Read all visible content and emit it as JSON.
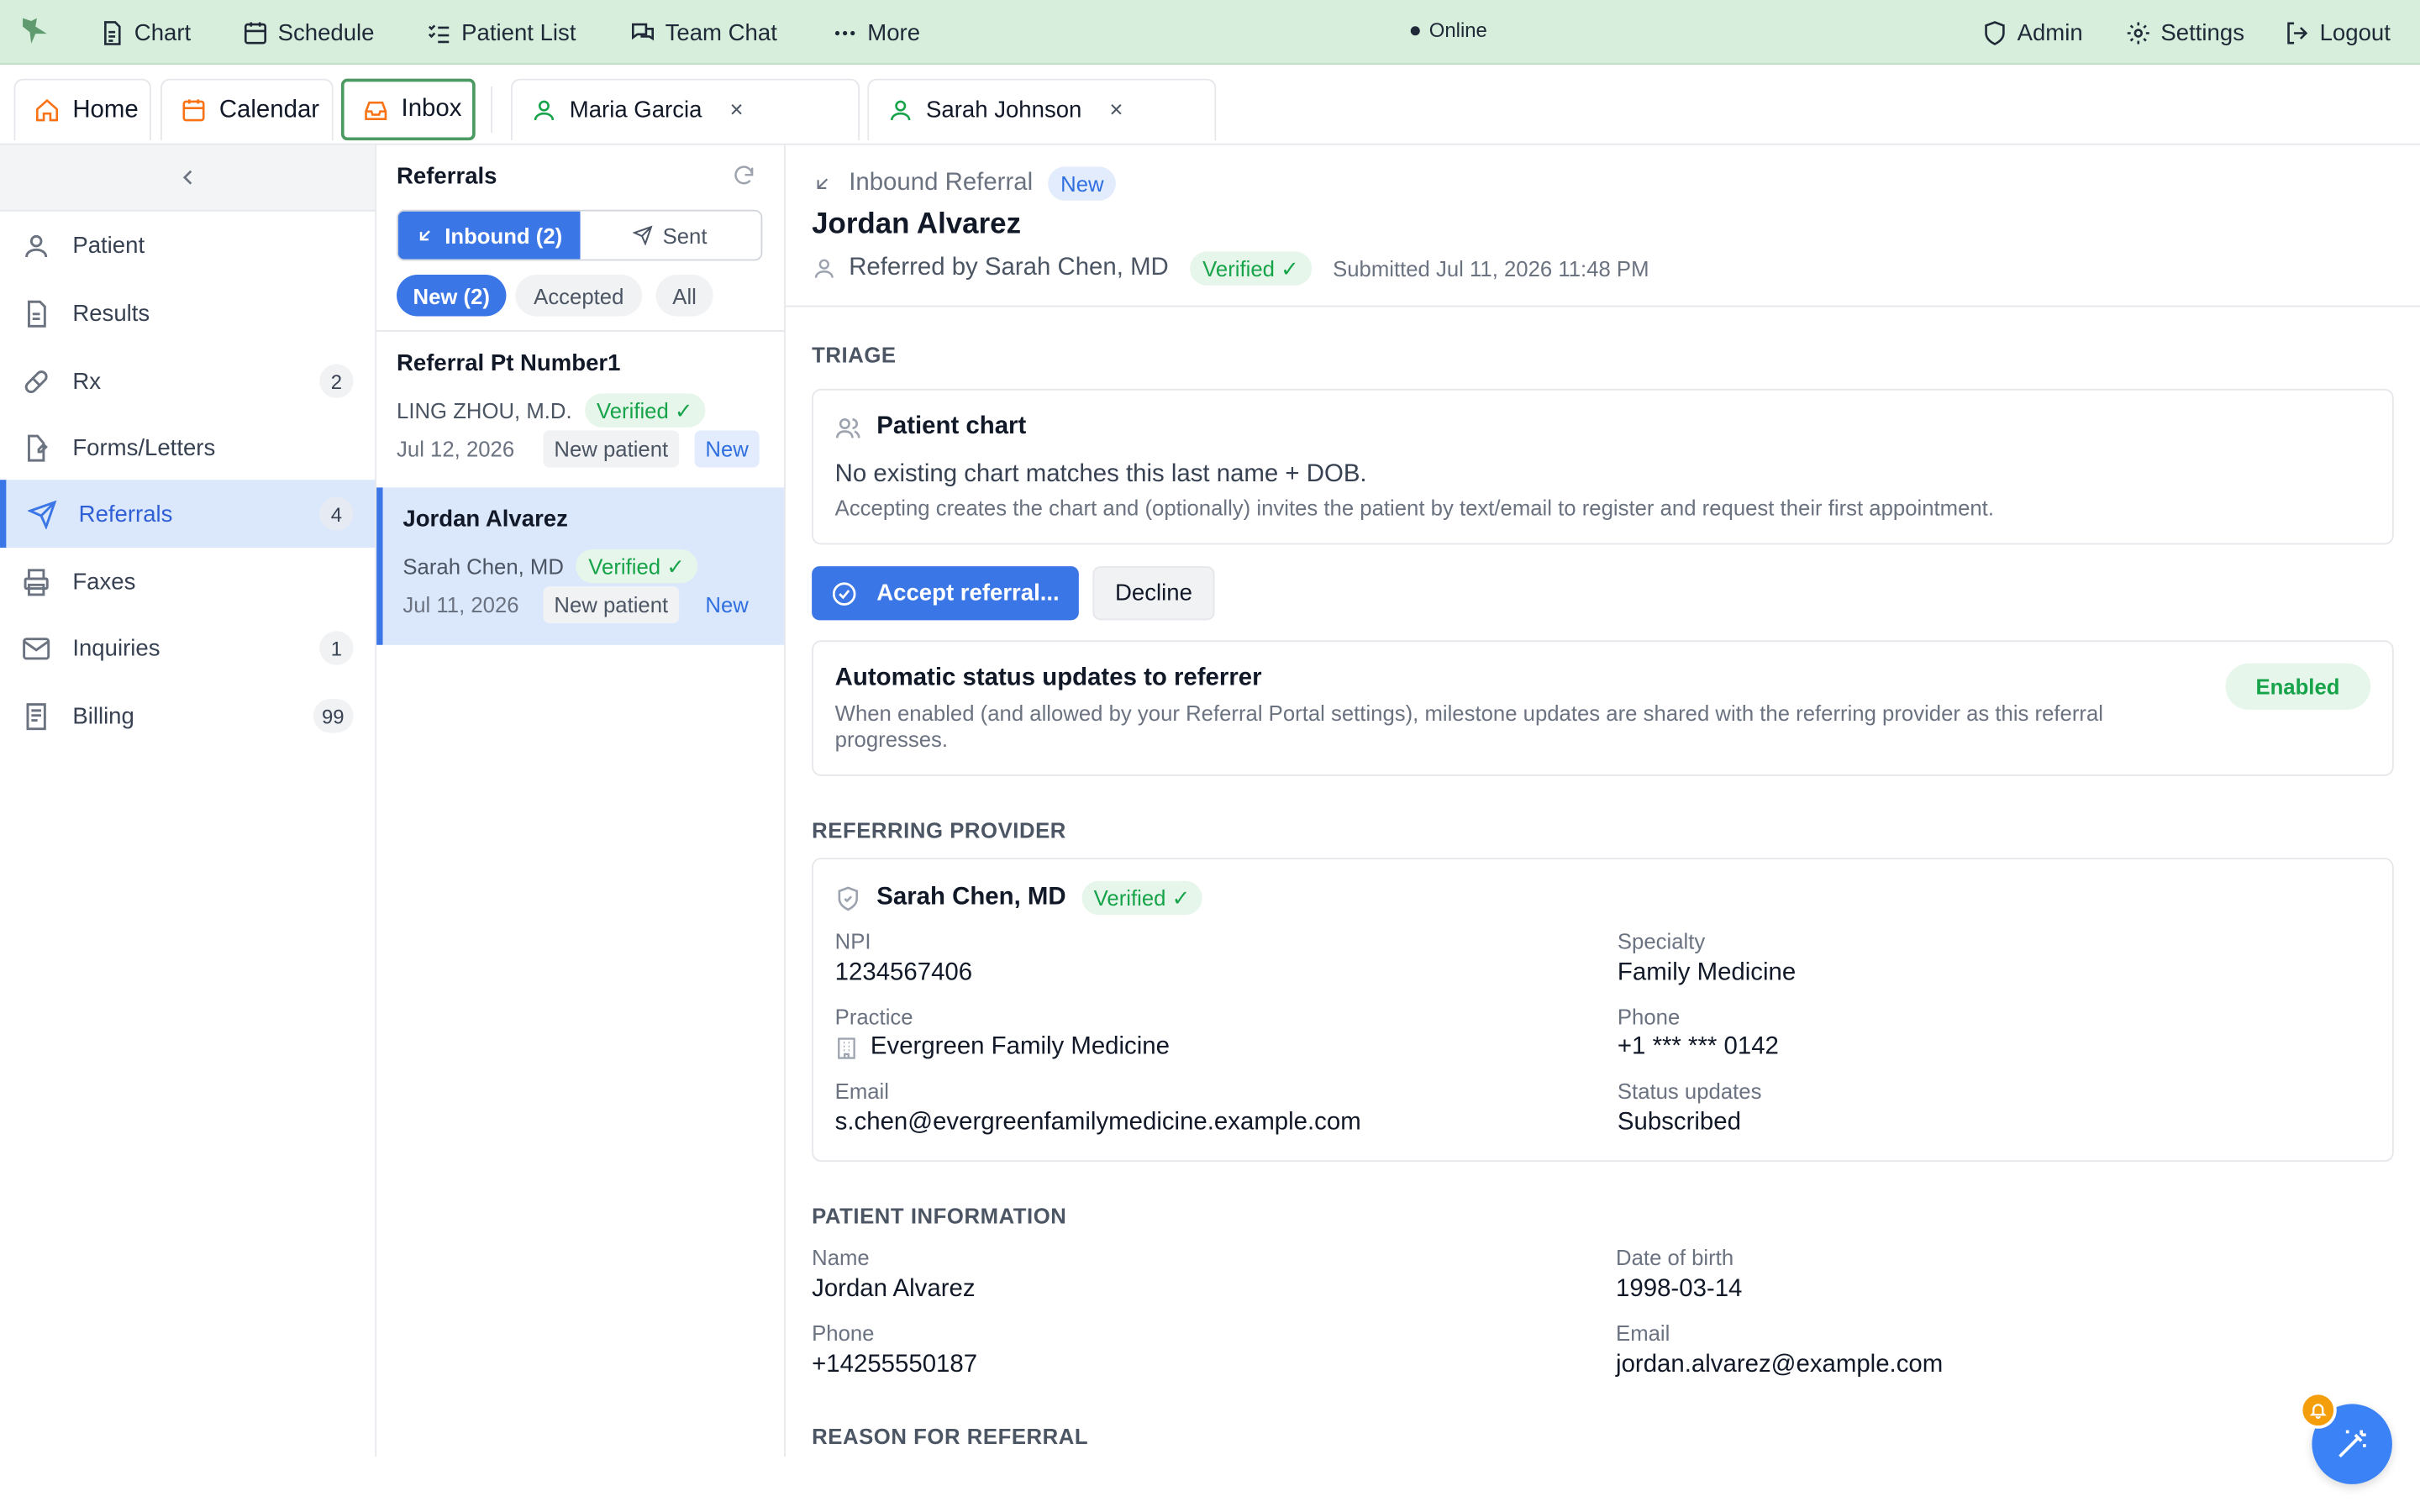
{
  "nav": {
    "logo": "bird-logo",
    "items": [
      {
        "label": "Chart",
        "icon": "document-icon"
      },
      {
        "label": "Schedule",
        "icon": "calendar-icon"
      },
      {
        "label": "Patient List",
        "icon": "list-check-icon"
      },
      {
        "label": "Team Chat",
        "icon": "chat-icon"
      },
      {
        "label": "More",
        "icon": "ellipsis-icon"
      }
    ],
    "status": "Online",
    "right": [
      {
        "label": "Admin",
        "icon": "shield-icon"
      },
      {
        "label": "Settings",
        "icon": "gear-icon"
      },
      {
        "label": "Logout",
        "icon": "logout-icon"
      }
    ]
  },
  "tabs": {
    "fixed": [
      {
        "label": "Home",
        "icon": "home-icon"
      },
      {
        "label": "Calendar",
        "icon": "calendar-icon"
      },
      {
        "label": "Inbox",
        "icon": "inbox-icon"
      }
    ],
    "patients": [
      {
        "label": "Maria Garcia",
        "close": "×"
      },
      {
        "label": "Sarah Johnson",
        "close": "×"
      }
    ]
  },
  "sidebar": {
    "items": [
      {
        "label": "Patient",
        "icon": "user-icon",
        "count": ""
      },
      {
        "label": "Results",
        "icon": "file-icon",
        "count": ""
      },
      {
        "label": "Rx",
        "icon": "pill-icon",
        "count": "2"
      },
      {
        "label": "Forms/Letters",
        "icon": "form-icon",
        "count": ""
      },
      {
        "label": "Referrals",
        "icon": "send-icon",
        "count": "4"
      },
      {
        "label": "Faxes",
        "icon": "printer-icon",
        "count": ""
      },
      {
        "label": "Inquiries",
        "icon": "mail-icon",
        "count": "1"
      },
      {
        "label": "Billing",
        "icon": "receipt-icon",
        "count": "99"
      }
    ]
  },
  "list": {
    "title": "Referrals",
    "segments": {
      "inbound": "Inbound (2)",
      "sent": "Sent"
    },
    "filters": {
      "new": "New (2)",
      "accepted": "Accepted",
      "all": "All"
    },
    "items": [
      {
        "name": "Referral Pt Number1",
        "referrer": "LING ZHOU, M.D.",
        "verified": "Verified ✓",
        "date": "Jul 12, 2026",
        "tag": "New patient",
        "status": "New"
      },
      {
        "name": "Jordan Alvarez",
        "referrer": "Sarah Chen, MD",
        "verified": "Verified ✓",
        "date": "Jul 11, 2026",
        "tag": "New patient",
        "status": "New"
      }
    ]
  },
  "detail": {
    "type_label": "Inbound Referral",
    "status": "New",
    "patient_name": "Jordan Alvarez",
    "referred_by": "Referred by Sarah Chen, MD",
    "verified": "Verified ✓",
    "submitted": "Submitted Jul 11, 2026 11:48 PM",
    "triage": {
      "section": "TRIAGE",
      "chart_title": "Patient chart",
      "chart_msg": "No existing chart matches this last name + DOB.",
      "chart_note": "Accepting creates the chart and (optionally) invites the patient by text/email to register and request their first appointment.",
      "accept": "Accept referral...",
      "decline": "Decline",
      "auto_title": "Automatic status updates to referrer",
      "auto_desc": "When enabled (and allowed by your Referral Portal settings), milestone updates are shared with the referring provider as this referral progresses.",
      "auto_state": "Enabled"
    },
    "provider": {
      "section": "REFERRING PROVIDER",
      "name": "Sarah Chen, MD",
      "verified": "Verified ✓",
      "fields": {
        "npi_label": "NPI",
        "npi": "1234567406",
        "specialty_label": "Specialty",
        "specialty": "Family Medicine",
        "practice_label": "Practice",
        "practice": "Evergreen Family Medicine",
        "phone_label": "Phone",
        "phone": "+1 *** *** 0142",
        "email_label": "Email",
        "email": "s.chen@evergreenfamilymedicine.example.com",
        "updates_label": "Status updates",
        "updates": "Subscribed"
      }
    },
    "patient": {
      "section": "PATIENT INFORMATION",
      "name_label": "Name",
      "name": "Jordan Alvarez",
      "dob_label": "Date of birth",
      "dob": "1998-03-14",
      "phone_label": "Phone",
      "phone": "+14255550187",
      "email_label": "Email",
      "email": "jordan.alvarez@example.com"
    },
    "reason_section": "REASON FOR REFERRAL"
  },
  "colors": {
    "accent": "#3b76e6",
    "topbar": "#d6eedb",
    "verified": "#16a34a",
    "fab": "#3b82f6",
    "notify": "#f59e0b"
  }
}
